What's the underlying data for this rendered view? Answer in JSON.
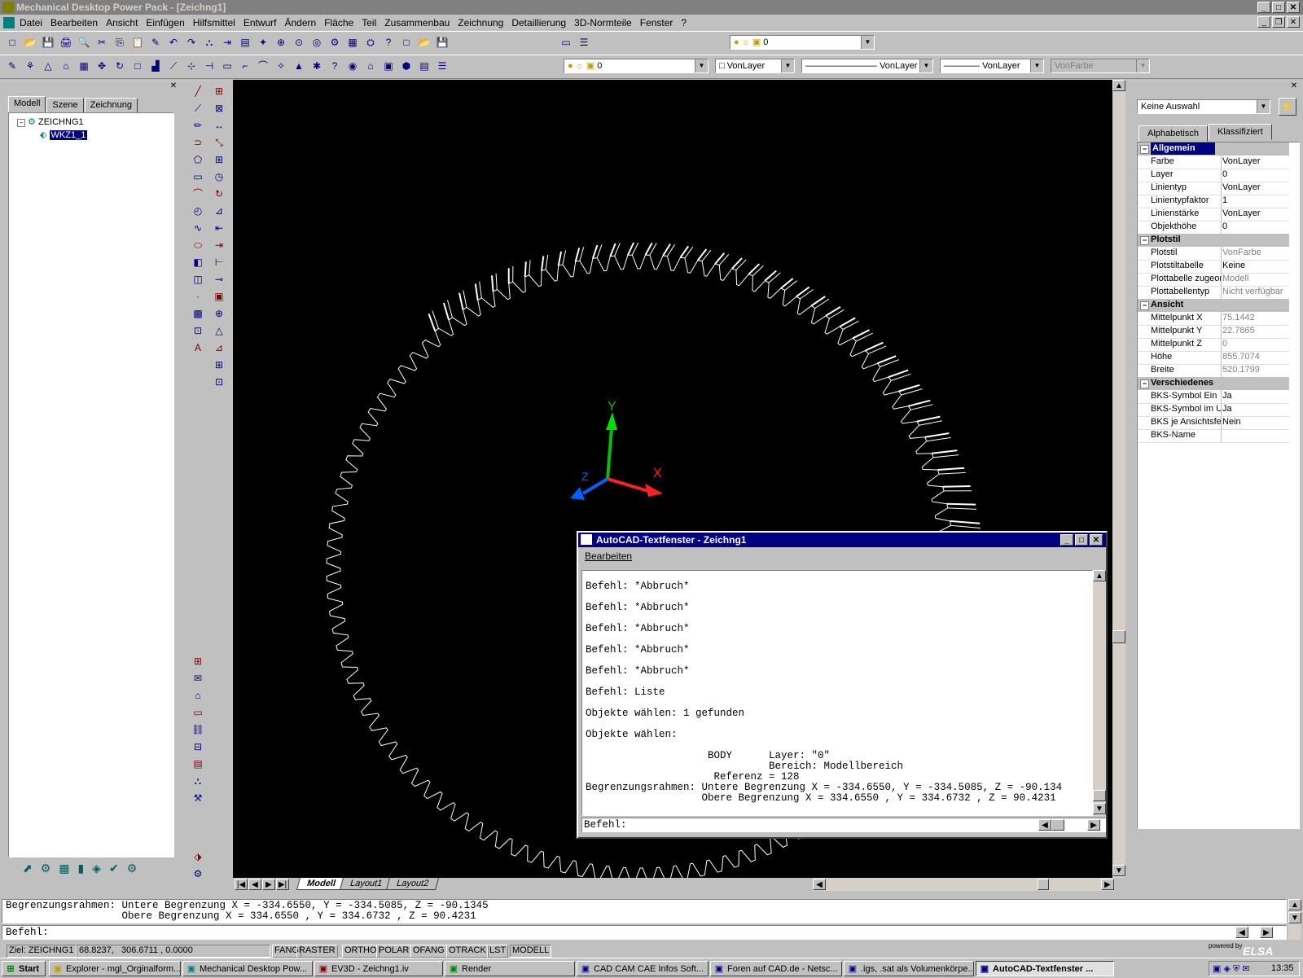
{
  "app": {
    "title": "Mechanical Desktop Power Pack - [Zeichng1]"
  },
  "menu": [
    "Datei",
    "Bearbeiten",
    "Ansicht",
    "Einfügen",
    "Hilfsmittel",
    "Entwurf",
    "Ändern",
    "Fläche",
    "Teil",
    "Zusammenbau",
    "Zeichnung",
    "Detaillierung",
    "3D-Normteile",
    "Fenster",
    "?"
  ],
  "toolbar1": {
    "layer_combo": "0"
  },
  "toolbar2": {
    "layer_combo": "0",
    "color_combo": "VonLayer",
    "linetype_combo": "VonLayer",
    "lineweight_combo": "VonLayer",
    "plotstyle_combo": "VonFarbe"
  },
  "browser": {
    "tabs": [
      "Modell",
      "Szene",
      "Zeichnung"
    ],
    "tree": {
      "root": "ZEICHNG1",
      "child": "WKZ1_1"
    }
  },
  "viewport": {
    "ucs": {
      "x": "X",
      "y": "Y",
      "z": "Z"
    },
    "layout_tabs": [
      "Modell",
      "Layout1",
      "Layout2"
    ]
  },
  "properties": {
    "selection": "Keine Auswahl",
    "tabs": [
      "Alphabetisch",
      "Klassifiziert"
    ],
    "categories": [
      {
        "name": "Allgemein",
        "rows": [
          {
            "k": "Farbe",
            "v": "VonLayer"
          },
          {
            "k": "Layer",
            "v": "0"
          },
          {
            "k": "Linientyp",
            "v": "VonLayer"
          },
          {
            "k": "Linientypfaktor",
            "v": "1"
          },
          {
            "k": "Linienstärke",
            "v": "VonLayer"
          },
          {
            "k": "Objekthöhe",
            "v": "0"
          }
        ]
      },
      {
        "name": "Plotstil",
        "rows": [
          {
            "k": "Plotstil",
            "v": "VonFarbe"
          },
          {
            "k": "Plotstiltabelle",
            "v": "Keine"
          },
          {
            "k": "Plottabelle zugeor",
            "v": "Modell"
          },
          {
            "k": "Plottabellentyp",
            "v": "Nicht verfügbar"
          }
        ]
      },
      {
        "name": "Ansicht",
        "rows": [
          {
            "k": "Mittelpunkt X",
            "v": "75.1442"
          },
          {
            "k": "Mittelpunkt Y",
            "v": "22.7865"
          },
          {
            "k": "Mittelpunkt Z",
            "v": "0"
          },
          {
            "k": "Höhe",
            "v": "855.7074"
          },
          {
            "k": "Breite",
            "v": "520.1799"
          }
        ]
      },
      {
        "name": "Verschiedenes",
        "rows": [
          {
            "k": "BKS-Symbol Ein",
            "v": "Ja"
          },
          {
            "k": "BKS-Symbol im Ur",
            "v": "Ja"
          },
          {
            "k": "BKS je Ansichtsfe",
            "v": "Nein"
          },
          {
            "k": "BKS-Name",
            "v": ""
          }
        ]
      }
    ]
  },
  "text_window": {
    "title": "AutoCAD-Textfenster - Zeichng1",
    "menu": "Bearbeiten",
    "lines": [
      "Befehl: *Abbruch*",
      "Befehl: *Abbruch*",
      "Befehl: *Abbruch*",
      "Befehl: *Abbruch*",
      "Befehl: *Abbruch*",
      "Befehl: Liste",
      "Objekte wählen: 1 gefunden",
      "Objekte wählen:",
      "                    BODY      Layer: \"0\"",
      "                              Bereich: Modellbereich",
      "                     Referenz = 128",
      "Begrenzungsrahmen: Untere Begrenzung X = -334.6550, Y = -334.5085, Z = -90.134",
      "                   Obere Begrenzung X = 334.6550 , Y = 334.6732 , Z = 90.4231"
    ],
    "prompt": "Befehl:"
  },
  "command_line": {
    "line1": "Begrenzungsrahmen: Untere Begrenzung X = -334.6550, Y = -334.5085, Z = -90.1345",
    "line2": "                   Obere Begrenzung X = 334.6550 , Y = 334.6732 , Z = 90.4231",
    "prompt": "Befehl:"
  },
  "status_bar": {
    "target": "Ziel: ZEICHNG1",
    "coords": "68.8237,   306.6711 , 0.0000",
    "toggles": [
      "FANG",
      "RASTER",
      "ORTHO",
      "POLAR",
      "OFANG",
      "OTRACK",
      "LST",
      "MODELL"
    ],
    "brand": "ELSA",
    "powered": "powered by"
  },
  "taskbar": {
    "start": "Start",
    "tasks": [
      "Explorer - mgl_Orginalform...",
      "Mechanical Desktop Pow...",
      "EV3D - Zeichng1.iv",
      "Render",
      "CAD CAM CAE Infos Soft...",
      "Foren auf CAD.de - Netsc...",
      ".igs, .sat als Volumenkörpe...",
      "AutoCAD-Textfenster ..."
    ],
    "clock": "13:35"
  },
  "colors": {
    "titlebar_active": "#000080",
    "viewport_bg": "#000000",
    "ucs_x": "#ff0000",
    "ucs_y": "#00c000",
    "ucs_z": "#0060ff"
  }
}
